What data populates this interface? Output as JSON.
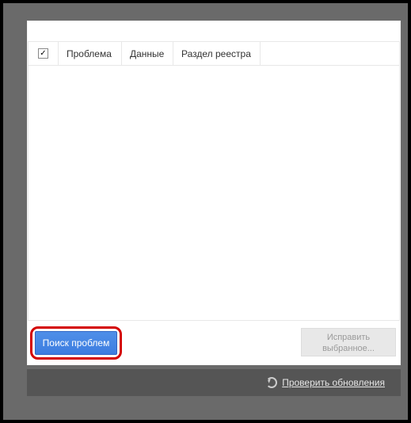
{
  "table": {
    "headers": {
      "problem": "Проблема",
      "data": "Данные",
      "registry": "Раздел реестра"
    },
    "select_all_checked": true
  },
  "buttons": {
    "search": "Поиск проблем",
    "fix_line1": "Исправить",
    "fix_line2": "выбранное..."
  },
  "footer": {
    "check_updates": "Проверить обновления"
  }
}
